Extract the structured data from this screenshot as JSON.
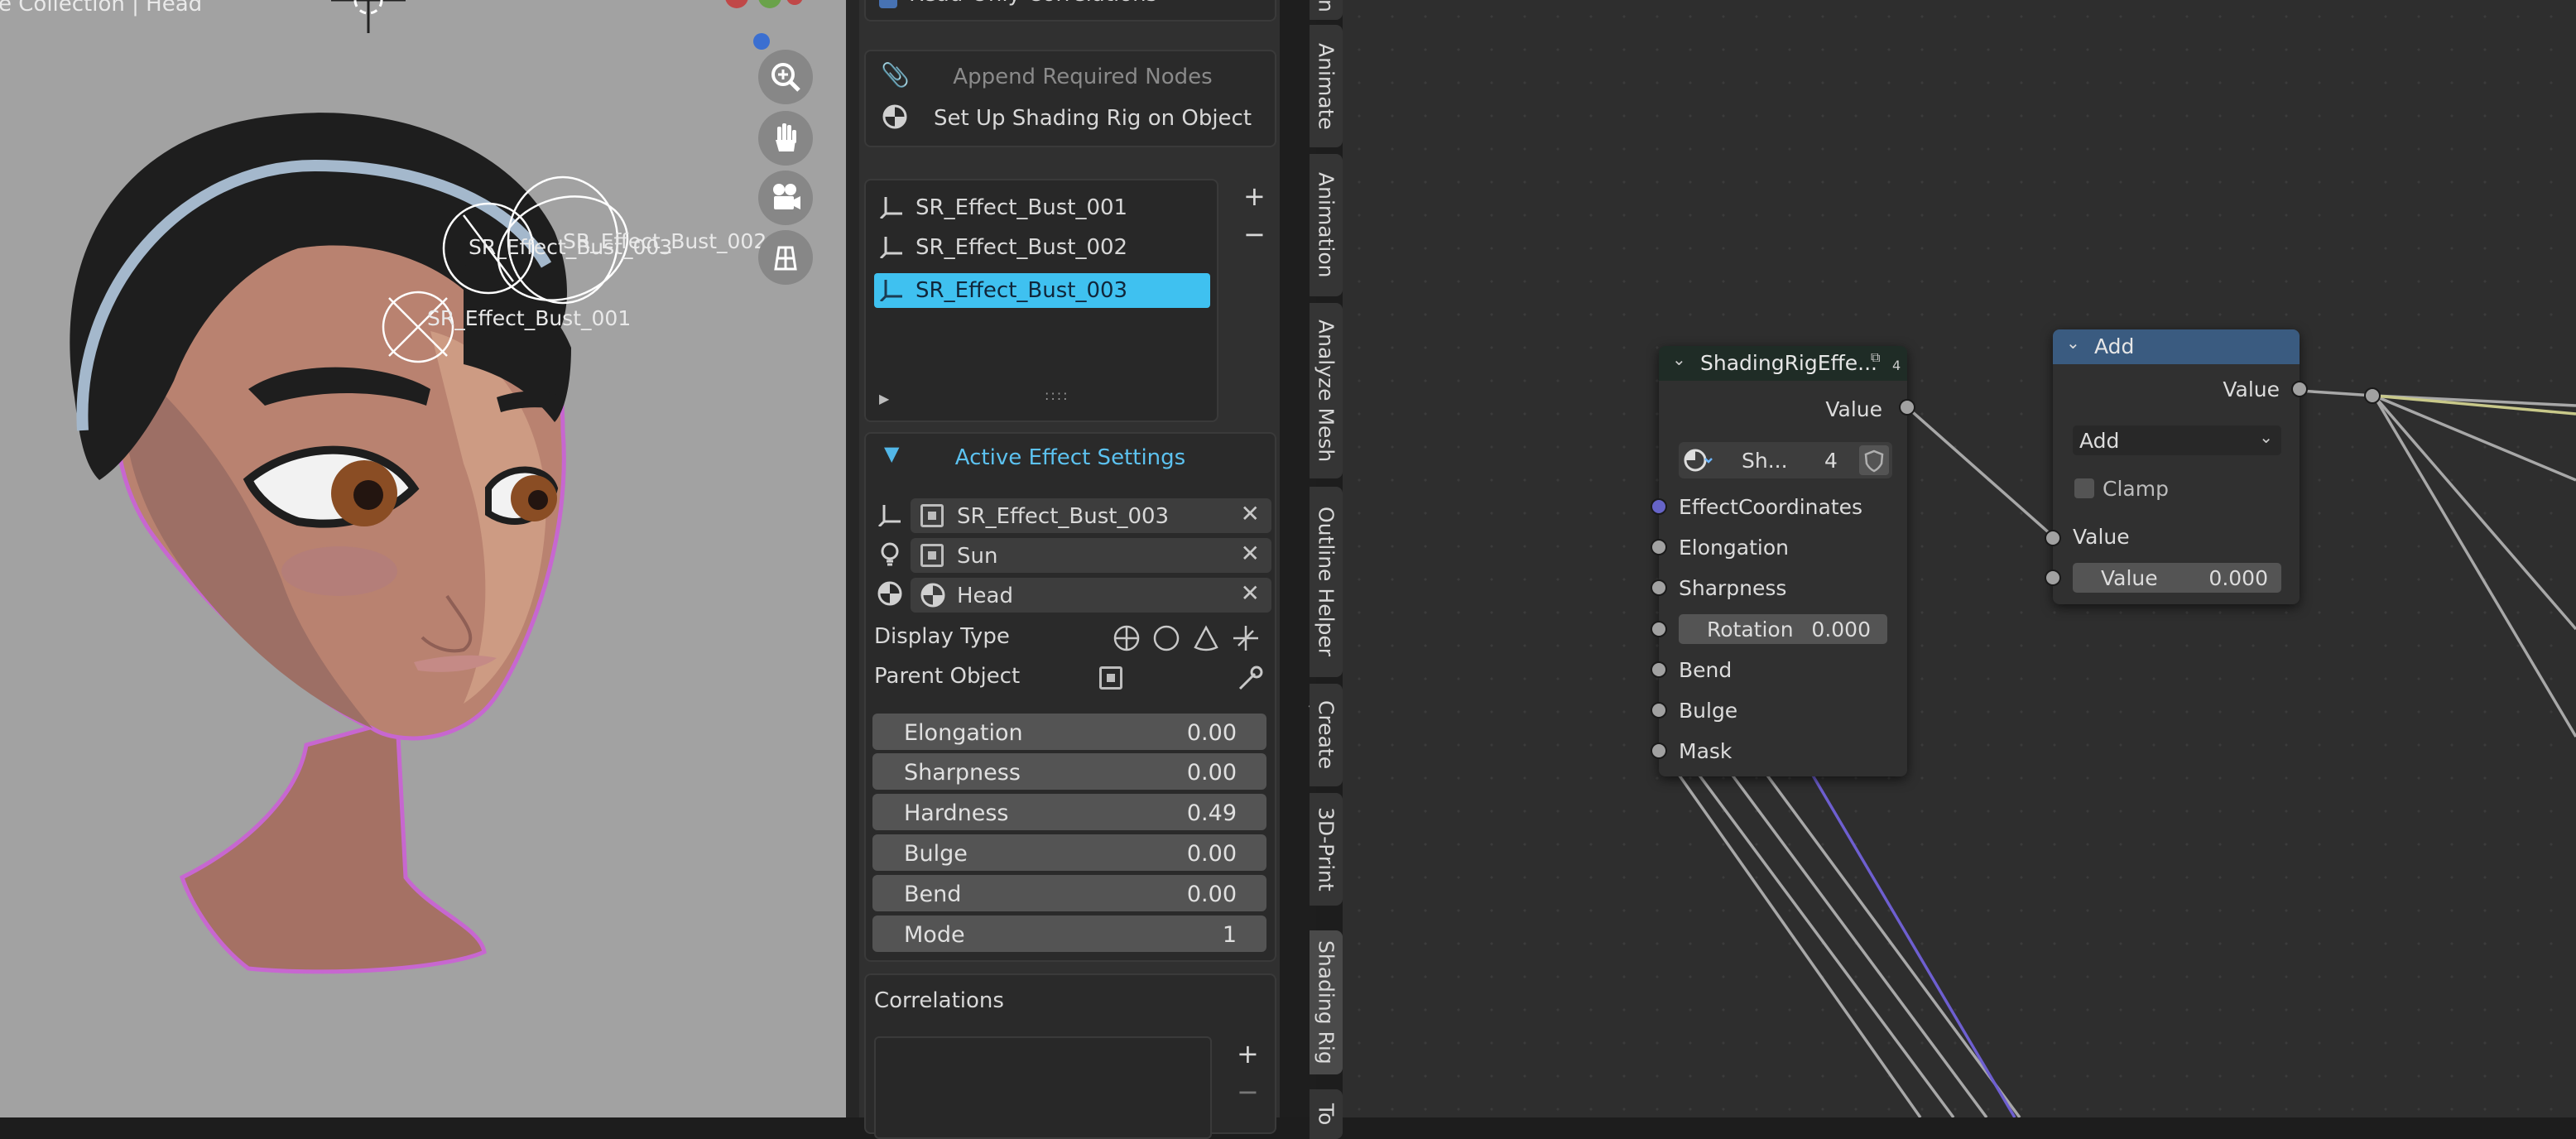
{
  "viewport": {
    "header_text": "e Collection | Head",
    "empty_labels": [
      "SR_Effect_Bust_003",
      "SR_Effect_Bust_002",
      "SR_Effect_Bust_001"
    ],
    "nav_icons": [
      "zoom-icon",
      "hand-icon",
      "camera-icon",
      "grid-icon"
    ]
  },
  "panel": {
    "top_checkbox_label": "Read-Only Correlations",
    "append_nodes_label": "Append Required Nodes",
    "setup_rig_label": "Set Up Shading Rig on Object",
    "effects_list": [
      "SR_Effect_Bust_001",
      "SR_Effect_Bust_002",
      "SR_Effect_Bust_003"
    ],
    "selected_effect_index": 2,
    "list_add": "+",
    "list_remove": "−",
    "active_settings": {
      "title": "Active Effect Settings",
      "object_rows": [
        {
          "icon": "empty-axes-icon",
          "name": "SR_Effect_Bust_003"
        },
        {
          "icon": "light-bulb-icon",
          "name": "Sun"
        },
        {
          "icon": "material-sphere-icon",
          "name": "Head"
        }
      ],
      "display_type_label": "Display Type",
      "parent_object_label": "Parent Object",
      "properties": [
        {
          "label": "Elongation",
          "value": "0.00"
        },
        {
          "label": "Sharpness",
          "value": "0.00"
        },
        {
          "label": "Hardness",
          "value": "0.49"
        },
        {
          "label": "Bulge",
          "value": "0.00"
        },
        {
          "label": "Bend",
          "value": "0.00"
        },
        {
          "label": "Mode",
          "value": "1"
        }
      ]
    },
    "correlations": {
      "title": "Correlations",
      "add": "+",
      "remove": "−"
    }
  },
  "tabs": [
    "n",
    "Animate",
    "Animation",
    "Analyze Mesh",
    "Outline Helper",
    "Create",
    "3D-Print",
    "Shading Rig",
    "To"
  ],
  "nodes": {
    "group_node": {
      "title": "ShadingRigEffe...",
      "users": "4",
      "output_value": "Value",
      "datablock_name": "Sh...",
      "datablock_users": "4",
      "inputs": [
        "EffectCoordinates",
        "Elongation",
        "Sharpness"
      ],
      "rotation_label": "Rotation",
      "rotation_value": "0.000",
      "inputs2": [
        "Bend",
        "Bulge",
        "Mask"
      ]
    },
    "add_node": {
      "title": "Add",
      "output_value": "Value",
      "operation": "Add",
      "clamp_label": "Clamp",
      "input_value": "Value",
      "input_value2_label": "Value",
      "input_value2": "0.000"
    }
  }
}
